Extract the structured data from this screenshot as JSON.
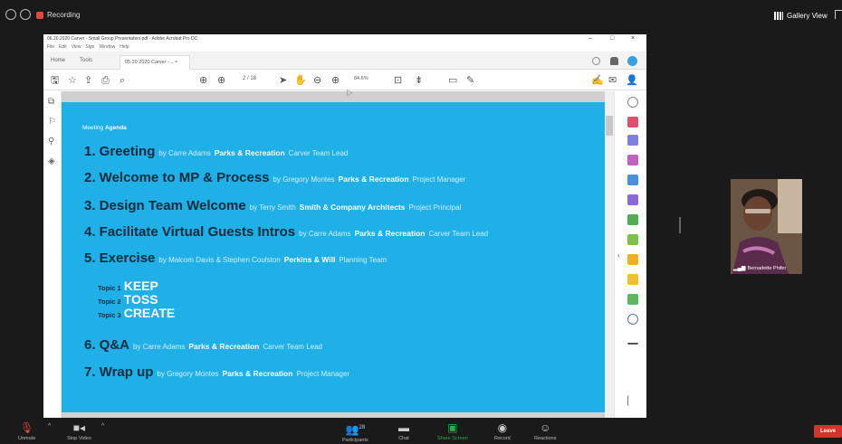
{
  "zoom_bar": {
    "recording_label": "Recording",
    "gallery_view_label": "Gallery View"
  },
  "acrobat": {
    "window_title": "06.20.2020 Carver - Small Group Presentation.pdf - Adobe Acrobat Pro DC",
    "menu": [
      "File",
      "Edit",
      "View",
      "Sign",
      "Window",
      "Help"
    ],
    "tabs": {
      "home": "Home",
      "tools": "Tools",
      "document": "05.20 2020 Carver -...  ×"
    },
    "page_indicator": "2 / 18",
    "zoom_value": "84.6%",
    "agenda_heading_prefix": "Meeting",
    "agenda_heading_bold": "Agenda",
    "agenda": [
      {
        "title": "1. Greeting",
        "by": "by Carre Adams",
        "org": "Parks & Recreation",
        "role": "Carver Team Lead"
      },
      {
        "title": "2. Welcome to MP & Process",
        "by": "by Gregory Montes",
        "org": "Parks & Recreation",
        "role": "Project Manager"
      },
      {
        "title": "3. Design Team Welcome",
        "by": "by Terry Smith",
        "org": "Smith & Company Architects",
        "role": "Project Principal"
      },
      {
        "title": "4. Facilitate Virtual Guests Intros",
        "by": "by Carre Adams",
        "org": "Parks & Recreation",
        "role": "Carver Team Lead"
      },
      {
        "title": "5. Exercise",
        "by": "by Malcom Davis & Stephen Coulston",
        "org": "Perkins & Will",
        "role": "Planning Team"
      },
      {
        "title": "6. Q&A",
        "by": "by Carre Adams",
        "org": "Parks & Recreation",
        "role": "Carver Team Lead"
      },
      {
        "title": "7. Wrap up",
        "by": "by Gregory Montes",
        "org": "Parks & Recreation",
        "role": "Project Manager"
      }
    ],
    "topics": [
      {
        "label": "Topic 1",
        "word": "KEEP"
      },
      {
        "label": "Topic 2",
        "word": "TOSS"
      },
      {
        "label": "Topic 3",
        "word": "CREATE"
      }
    ]
  },
  "participant": {
    "name": "Bernadette Phifer"
  },
  "controls": {
    "unmute": "Unmute",
    "stop_video": "Stop Video",
    "participants": "Participants",
    "participants_count": "28",
    "chat": "Chat",
    "share_screen": "Share Screen",
    "record": "Record",
    "reactions": "Reactions",
    "leave": "Leave"
  },
  "colors": {
    "slide_bg": "#1eb0e6",
    "title_text": "#0d2b3c",
    "leave": "#d7322a",
    "share_green": "#22b14c"
  }
}
